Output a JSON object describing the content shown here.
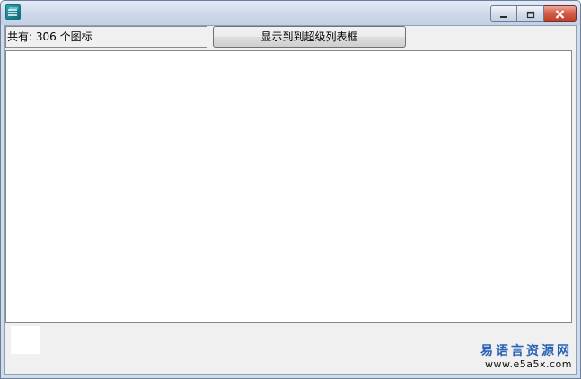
{
  "window": {
    "controls": {
      "minimize_icon": "minimize-icon",
      "maximize_icon": "maximize-icon",
      "close_icon": "close-icon"
    }
  },
  "toolbar": {
    "count_text": "共有: 306 个图标",
    "show_button_label": "显示到到超级列表框"
  },
  "watermark": {
    "title": "易语言资源网",
    "url": "www.e5a5x.com"
  },
  "colors": {
    "titlebar": "#cdd9ea",
    "client_bg": "#f0f0f0",
    "close_button": "#c1412a",
    "watermark_text": "#2a63b6"
  }
}
